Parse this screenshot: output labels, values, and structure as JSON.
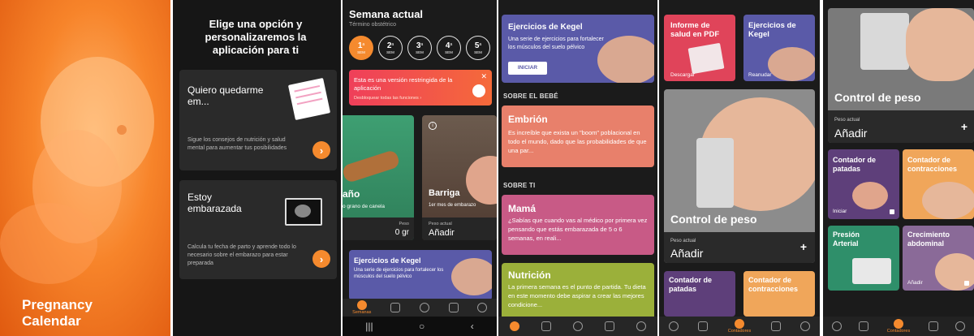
{
  "splash": {
    "title_line1": "Pregnancy",
    "title_line2": "Calendar"
  },
  "onboarding": {
    "heading": "Elige una opción y personalizaremos la aplicación para ti",
    "option1": {
      "title": "Quiero quedarme em...",
      "description": "Sigue los consejos de nutrición y salud mental para aumentar tus posibilidades",
      "icon": "calendar-hand-icon"
    },
    "option2": {
      "title": "Estoy embarazada",
      "description": "Calcula tu fecha de parto y aprende todo lo necesario sobre el embarazo para estar preparada",
      "icon": "ultrasound-icon"
    }
  },
  "weeks": {
    "title": "Semana actual",
    "subtitle": "Término obstétrico",
    "week_items": [
      {
        "num": "1",
        "sup": "a",
        "unit": "SEM"
      },
      {
        "num": "2",
        "sup": "a",
        "unit": "SEM"
      },
      {
        "num": "3",
        "sup": "a",
        "unit": "SEM"
      },
      {
        "num": "4",
        "sup": "a",
        "unit": "SEM"
      },
      {
        "num": "5",
        "sup": "a",
        "unit": "SEM"
      }
    ],
    "banner": {
      "text": "Esta es una versión restringida de la aplicación",
      "link": "Desbloquear todas las funciones ›"
    },
    "tile_size": {
      "title": "año",
      "sub": "o grano de canela",
      "label": "Peso",
      "value": "0 gr"
    },
    "tile_belly": {
      "title": "Barriga",
      "sub": "1er mes de embarazo",
      "label": "Peso actual",
      "value": "Añadir"
    },
    "kegel": {
      "title": "Ejercicios de Kegel",
      "description": "Una serie de ejercicios para fortalecer los músculos del suelo pélvico"
    },
    "nav": {
      "active_label": "Semanas"
    }
  },
  "articles": {
    "kegel": {
      "title": "Ejercicios de Kegel",
      "description": "Una serie de ejercicios para fortalecer los músculos del suelo pélvico",
      "button": "INICIAR"
    },
    "section_baby": "SOBRE EL BEBÉ",
    "embrion": {
      "title": "Embrión",
      "text": "Es increíble que exista un \"boom\" poblacional en todo el mundo, dado que las probabilidades de que una par..."
    },
    "section_you": "SOBRE TI",
    "mama": {
      "title": "Mamá",
      "text": "¿Sabías que cuando vas al médico por primera vez pensando que estás embarazada de 5 o 6 semanas, en reali..."
    },
    "nutricion": {
      "title": "Nutrición",
      "text": "La primera semana es el punto de partida. Tu dieta en este momento debe aspirar a crear las mejores condicione..."
    }
  },
  "tools": {
    "report": {
      "title": "Informe de salud en PDF",
      "sub": "Descargar"
    },
    "kegel": {
      "title": "Ejercicios de Kegel",
      "sub": "Reanudar"
    },
    "weight": {
      "title": "Control de peso",
      "label": "Peso actual",
      "value": "Añadir"
    },
    "kicks": {
      "title": "Contador de patadas"
    },
    "contractions": {
      "title": "Contador de contracciones"
    },
    "nav": {
      "active_label": "Contadores"
    }
  },
  "counters": {
    "weight": {
      "title": "Control de peso",
      "label": "Peso actual",
      "value": "Añadir"
    },
    "kicks": {
      "title": "Contador de patadas",
      "sub": "Iniciar"
    },
    "contractions": {
      "title": "Contador de contracciones"
    },
    "pressure": {
      "title": "Presión Arterial"
    },
    "belly": {
      "title": "Crecimiento abdominal",
      "sub": "Añadir"
    },
    "nav": {
      "active_label": "Contadores"
    }
  },
  "colors": {
    "accent": "#f58a2e",
    "background_dark": "#1b1b1b",
    "kegel_card": "#5a5aa8",
    "embrion_card": "#e8806b",
    "mama_card": "#c85a86",
    "nutricion_card": "#9bb03a"
  }
}
